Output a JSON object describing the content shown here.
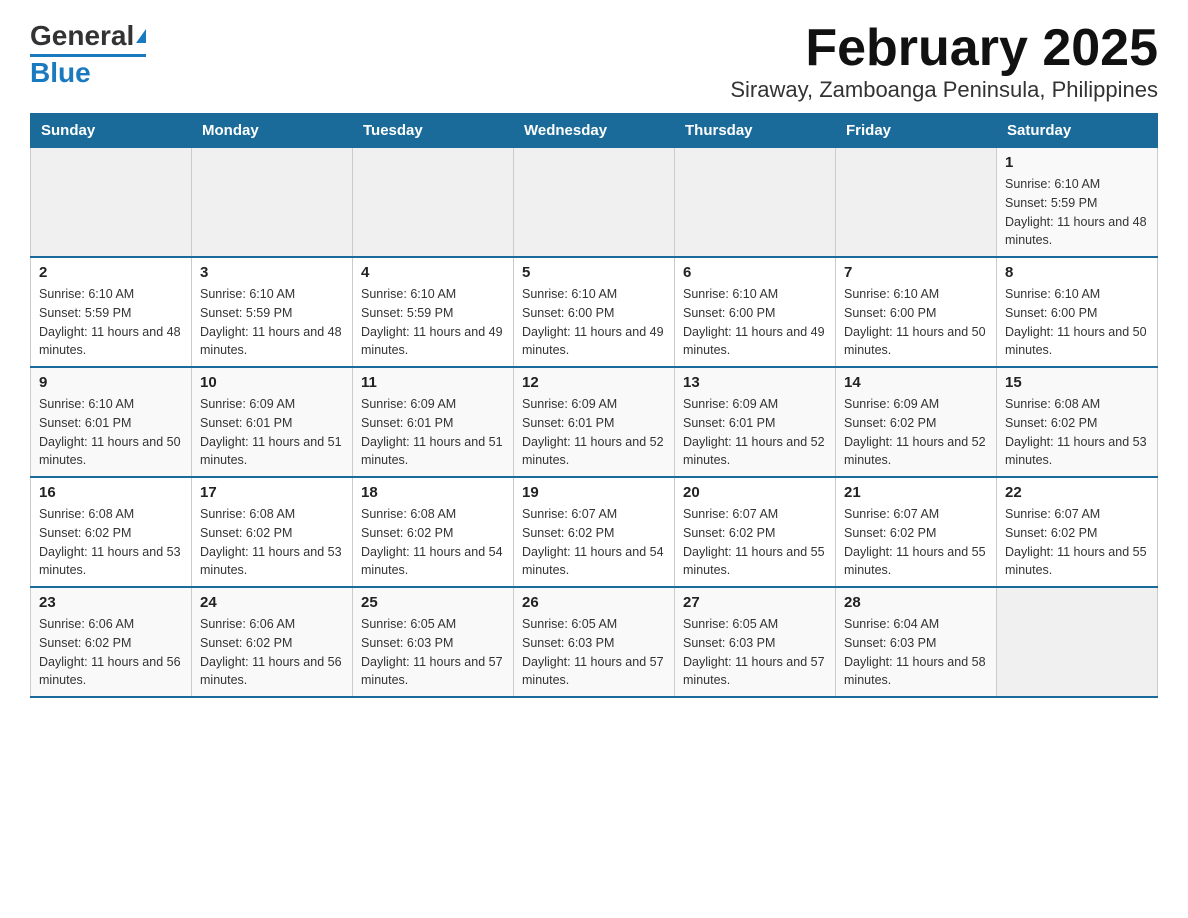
{
  "header": {
    "logo_main": "General",
    "logo_accent": "Blue",
    "title": "February 2025",
    "subtitle": "Siraway, Zamboanga Peninsula, Philippines"
  },
  "calendar": {
    "weekdays": [
      "Sunday",
      "Monday",
      "Tuesday",
      "Wednesday",
      "Thursday",
      "Friday",
      "Saturday"
    ],
    "weeks": [
      [
        {
          "day": "",
          "info": ""
        },
        {
          "day": "",
          "info": ""
        },
        {
          "day": "",
          "info": ""
        },
        {
          "day": "",
          "info": ""
        },
        {
          "day": "",
          "info": ""
        },
        {
          "day": "",
          "info": ""
        },
        {
          "day": "1",
          "info": "Sunrise: 6:10 AM\nSunset: 5:59 PM\nDaylight: 11 hours and 48 minutes."
        }
      ],
      [
        {
          "day": "2",
          "info": "Sunrise: 6:10 AM\nSunset: 5:59 PM\nDaylight: 11 hours and 48 minutes."
        },
        {
          "day": "3",
          "info": "Sunrise: 6:10 AM\nSunset: 5:59 PM\nDaylight: 11 hours and 48 minutes."
        },
        {
          "day": "4",
          "info": "Sunrise: 6:10 AM\nSunset: 5:59 PM\nDaylight: 11 hours and 49 minutes."
        },
        {
          "day": "5",
          "info": "Sunrise: 6:10 AM\nSunset: 6:00 PM\nDaylight: 11 hours and 49 minutes."
        },
        {
          "day": "6",
          "info": "Sunrise: 6:10 AM\nSunset: 6:00 PM\nDaylight: 11 hours and 49 minutes."
        },
        {
          "day": "7",
          "info": "Sunrise: 6:10 AM\nSunset: 6:00 PM\nDaylight: 11 hours and 50 minutes."
        },
        {
          "day": "8",
          "info": "Sunrise: 6:10 AM\nSunset: 6:00 PM\nDaylight: 11 hours and 50 minutes."
        }
      ],
      [
        {
          "day": "9",
          "info": "Sunrise: 6:10 AM\nSunset: 6:01 PM\nDaylight: 11 hours and 50 minutes."
        },
        {
          "day": "10",
          "info": "Sunrise: 6:09 AM\nSunset: 6:01 PM\nDaylight: 11 hours and 51 minutes."
        },
        {
          "day": "11",
          "info": "Sunrise: 6:09 AM\nSunset: 6:01 PM\nDaylight: 11 hours and 51 minutes."
        },
        {
          "day": "12",
          "info": "Sunrise: 6:09 AM\nSunset: 6:01 PM\nDaylight: 11 hours and 52 minutes."
        },
        {
          "day": "13",
          "info": "Sunrise: 6:09 AM\nSunset: 6:01 PM\nDaylight: 11 hours and 52 minutes."
        },
        {
          "day": "14",
          "info": "Sunrise: 6:09 AM\nSunset: 6:02 PM\nDaylight: 11 hours and 52 minutes."
        },
        {
          "day": "15",
          "info": "Sunrise: 6:08 AM\nSunset: 6:02 PM\nDaylight: 11 hours and 53 minutes."
        }
      ],
      [
        {
          "day": "16",
          "info": "Sunrise: 6:08 AM\nSunset: 6:02 PM\nDaylight: 11 hours and 53 minutes."
        },
        {
          "day": "17",
          "info": "Sunrise: 6:08 AM\nSunset: 6:02 PM\nDaylight: 11 hours and 53 minutes."
        },
        {
          "day": "18",
          "info": "Sunrise: 6:08 AM\nSunset: 6:02 PM\nDaylight: 11 hours and 54 minutes."
        },
        {
          "day": "19",
          "info": "Sunrise: 6:07 AM\nSunset: 6:02 PM\nDaylight: 11 hours and 54 minutes."
        },
        {
          "day": "20",
          "info": "Sunrise: 6:07 AM\nSunset: 6:02 PM\nDaylight: 11 hours and 55 minutes."
        },
        {
          "day": "21",
          "info": "Sunrise: 6:07 AM\nSunset: 6:02 PM\nDaylight: 11 hours and 55 minutes."
        },
        {
          "day": "22",
          "info": "Sunrise: 6:07 AM\nSunset: 6:02 PM\nDaylight: 11 hours and 55 minutes."
        }
      ],
      [
        {
          "day": "23",
          "info": "Sunrise: 6:06 AM\nSunset: 6:02 PM\nDaylight: 11 hours and 56 minutes."
        },
        {
          "day": "24",
          "info": "Sunrise: 6:06 AM\nSunset: 6:02 PM\nDaylight: 11 hours and 56 minutes."
        },
        {
          "day": "25",
          "info": "Sunrise: 6:05 AM\nSunset: 6:03 PM\nDaylight: 11 hours and 57 minutes."
        },
        {
          "day": "26",
          "info": "Sunrise: 6:05 AM\nSunset: 6:03 PM\nDaylight: 11 hours and 57 minutes."
        },
        {
          "day": "27",
          "info": "Sunrise: 6:05 AM\nSunset: 6:03 PM\nDaylight: 11 hours and 57 minutes."
        },
        {
          "day": "28",
          "info": "Sunrise: 6:04 AM\nSunset: 6:03 PM\nDaylight: 11 hours and 58 minutes."
        },
        {
          "day": "",
          "info": ""
        }
      ]
    ]
  }
}
